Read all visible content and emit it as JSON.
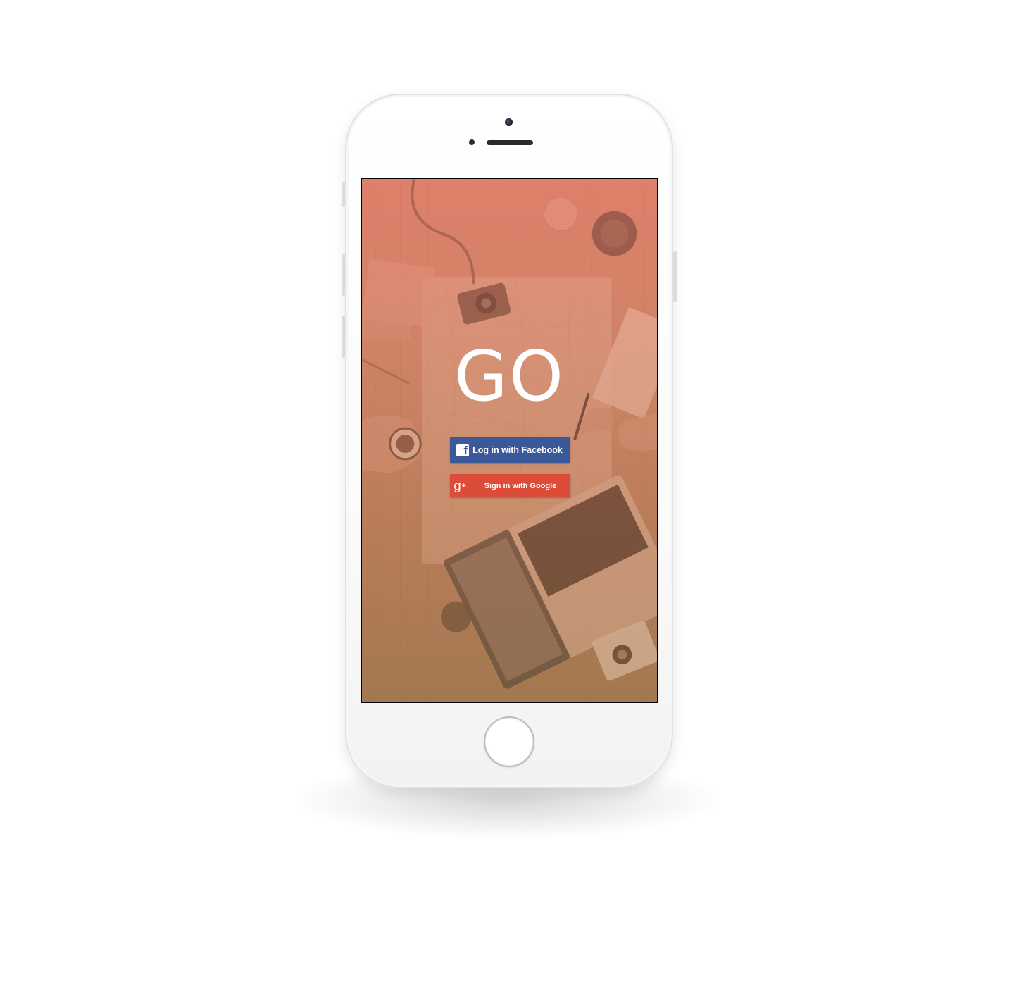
{
  "app": {
    "logo_text": "GO"
  },
  "login": {
    "facebook_label": "Log in with Facebook",
    "facebook_icon": "f",
    "google_label": "Sign in with Google",
    "google_icon": "g",
    "google_icon_plus": "+"
  },
  "colors": {
    "facebook": "#3b5998",
    "google": "#dd4b39",
    "overlay_top": "#d9806c",
    "overlay_bottom": "#9e7752"
  },
  "background": {
    "description_icon": "travel-desk-photo"
  }
}
